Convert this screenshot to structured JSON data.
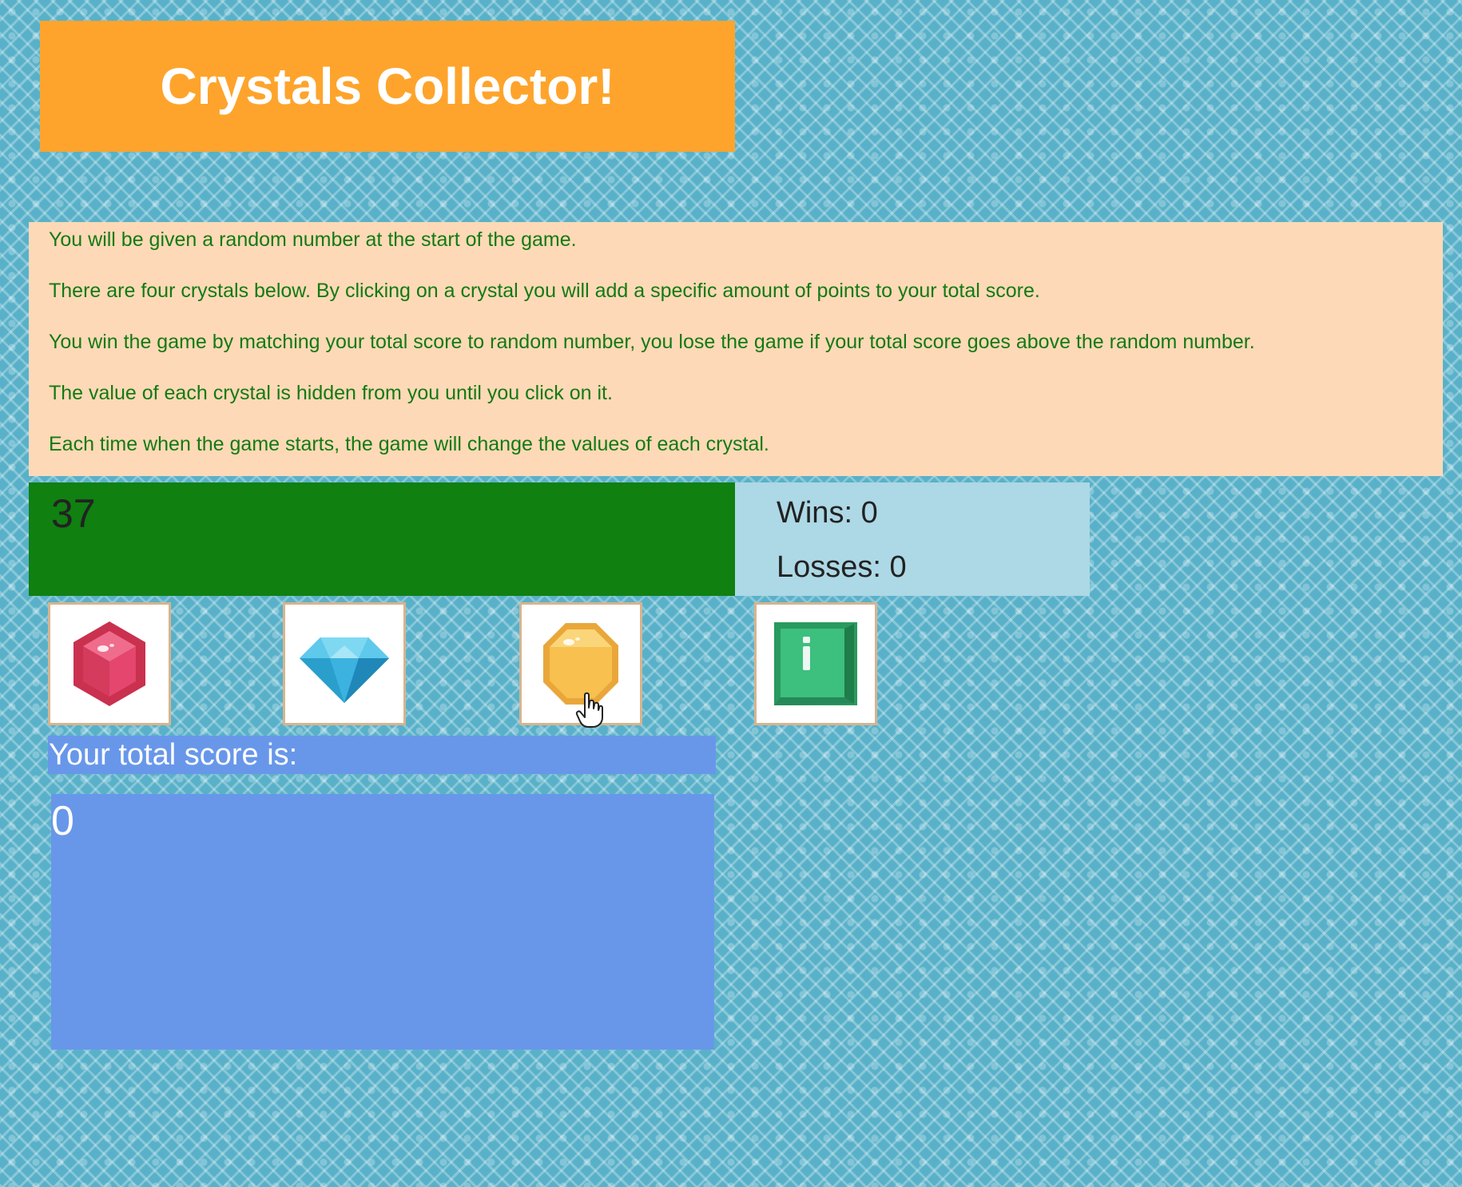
{
  "title": "Crystals Collector!",
  "instructions": [
    "You will be given a random number at the start of the game.",
    "There are four crystals below. By clicking on a crystal you will add a specific amount of points to your total score.",
    "You win the game by matching your total score to random number, you lose the game if your total score goes above the random number.",
    "The value of each crystal is hidden from you until you click on it.",
    "Each time when the game starts, the game will change the values of each crystal."
  ],
  "target_number": "37",
  "stats": {
    "wins_label": "Wins: ",
    "wins": "0",
    "losses_label": "Losses: ",
    "losses": "0"
  },
  "crystals": [
    {
      "name": "red-ruby-crystal-icon",
      "color": "#e4466e"
    },
    {
      "name": "blue-diamond-crystal-icon",
      "color": "#3bb7e0"
    },
    {
      "name": "yellow-topaz-crystal-icon",
      "color": "#f7c04f"
    },
    {
      "name": "green-emerald-crystal-icon",
      "color": "#3dbf7d"
    }
  ],
  "score": {
    "label": "Your total score is:",
    "value": "0"
  },
  "colors": {
    "title_bg": "#fea42c",
    "instructions_bg": "#fed9b7",
    "instructions_text": "#137a13",
    "target_bg": "#108011",
    "stats_bg": "#add8e6",
    "score_bg": "#6897ea",
    "page_bg": "#59b1c9"
  }
}
